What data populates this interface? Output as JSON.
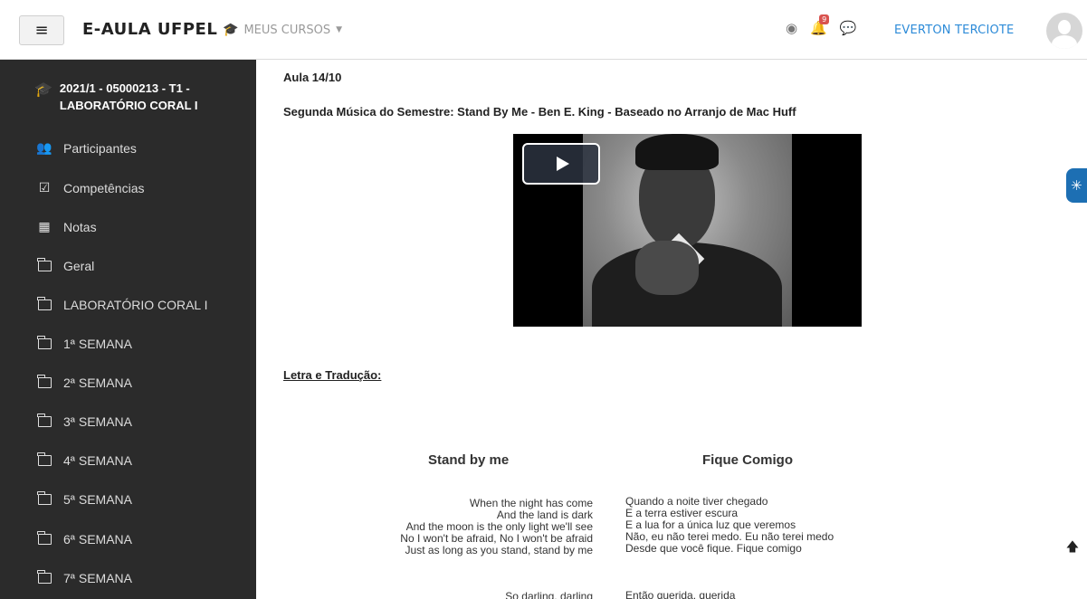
{
  "navbar": {
    "menu_icon": "hamburger-menu-icon",
    "menu_glyph": "≡",
    "brand": "E-AULA UFPEL",
    "courses_label": "MEUS CURSOS",
    "courses_icon": "graduation-cap-icon",
    "globe_icon": "globe-icon",
    "bell_icon": "bell-icon",
    "notification_count": "9",
    "chat_icon": "chat-bubble-icon",
    "username": "EVERTON TERCIOTE",
    "avatar_icon": "user-avatar-icon"
  },
  "sidebar": {
    "course": "2021/1 - 05000213 - T1 - LABORATÓRIO CORAL I",
    "items": [
      {
        "label": "Participantes",
        "icon": "users-icon"
      },
      {
        "label": "Competências",
        "icon": "checkbox-icon"
      },
      {
        "label": "Notas",
        "icon": "table-icon"
      },
      {
        "label": "Geral",
        "icon": "folder-icon"
      },
      {
        "label": "LABORATÓRIO CORAL I",
        "icon": "folder-icon"
      },
      {
        "label": "1ª SEMANA",
        "icon": "folder-icon"
      },
      {
        "label": "2ª SEMANA",
        "icon": "folder-icon"
      },
      {
        "label": "3ª SEMANA",
        "icon": "folder-icon"
      },
      {
        "label": "4ª SEMANA",
        "icon": "folder-icon"
      },
      {
        "label": "5ª SEMANA",
        "icon": "folder-icon"
      },
      {
        "label": "6ª SEMANA",
        "icon": "folder-icon"
      },
      {
        "label": "7ª SEMANA",
        "icon": "folder-icon"
      }
    ]
  },
  "main": {
    "aula_title": "Aula 14/10",
    "music_title": "Segunda Música do Semestre: Stand By Me - Ben E. King - Baseado no Arranjo de Mac Huff",
    "video_play_icon": "play-icon",
    "letra_heading": "Letra e Tradução:",
    "col_left_title": "Stand by me",
    "col_right_title": "Fique Comigo",
    "verse1_en": [
      "When the night has come",
      "And the land is dark",
      "And the moon is the only light we'll see",
      "No I won't be afraid, No I won't be afraid",
      "Just as long as you stand, stand by me"
    ],
    "verse1_pt": [
      "Quando a noite tiver chegado",
      "E a terra estiver escura",
      "E a lua for a única luz que veremos",
      "Não, eu não terei medo. Eu não terei medo",
      "Desde que você fique. Fique comigo"
    ],
    "verse2_en": [
      "So darling, darling"
    ],
    "verse2_pt": [
      "Então querida, querida"
    ]
  },
  "accessibility_icon": "accessibility-icon",
  "back_to_top_icon": "arrow-up-icon"
}
